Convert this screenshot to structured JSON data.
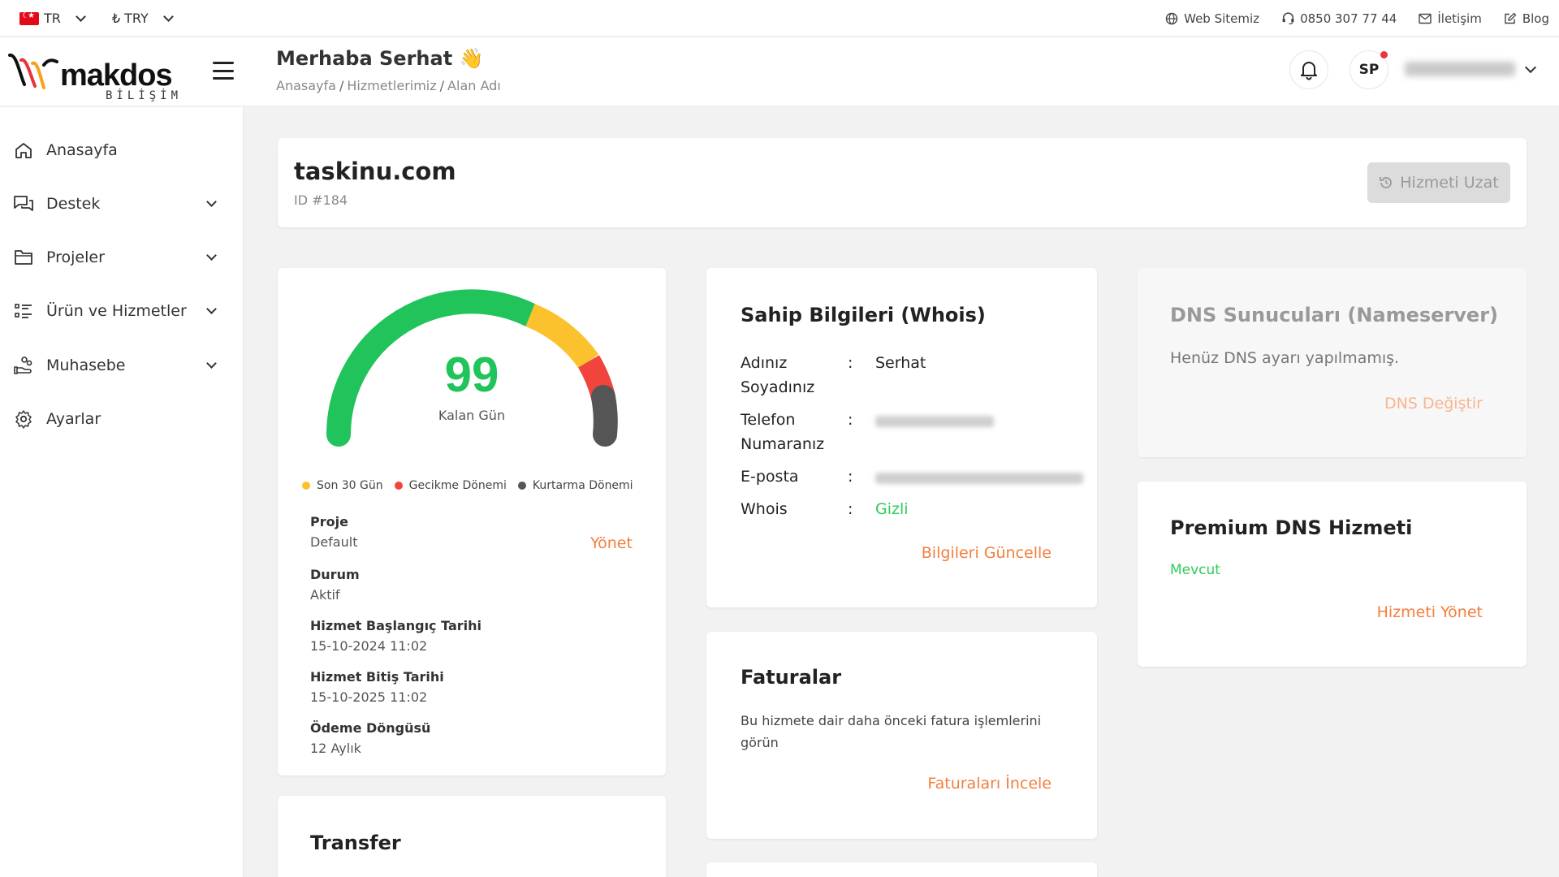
{
  "topbar": {
    "language": "TR",
    "currency": "₺ TRY",
    "links": [
      {
        "label": "Web Sitemiz",
        "icon": "globe-icon"
      },
      {
        "label": "0850 307 77 44",
        "icon": "headset-icon"
      },
      {
        "label": "İletişim",
        "icon": "mail-icon"
      },
      {
        "label": "Blog",
        "icon": "edit-icon"
      }
    ]
  },
  "header": {
    "logo": {
      "word": "makdos",
      "sub": "BİLİŞİM"
    },
    "greeting": "Merhaba Serhat 👋",
    "breadcrumb": [
      "Anasayfa",
      "Hizmetlerimiz",
      "Alan Adı"
    ],
    "avatar_initials": "SP"
  },
  "sidebar": {
    "items": [
      {
        "label": "Anasayfa",
        "icon": "home-icon"
      },
      {
        "label": "Destek",
        "icon": "chat-icon"
      },
      {
        "label": "Projeler",
        "icon": "folder-icon"
      },
      {
        "label": "Ürün ve Hizmetler",
        "icon": "list-icon"
      },
      {
        "label": "Muhasebe",
        "icon": "hand-coins-icon"
      },
      {
        "label": "Ayarlar",
        "icon": "gear-icon"
      }
    ]
  },
  "domain": {
    "name": "taskinu.com",
    "id": "ID #184",
    "renew_button": "Hizmeti Uzat"
  },
  "gauge": {
    "days_left": "99",
    "days_label": "Kalan Gün",
    "legend": [
      "Son 30 Gün",
      "Gecikme Dönemi",
      "Kurtarma Dönemi"
    ],
    "colors": {
      "active": "#20c45a",
      "last30": "#fcc22d",
      "late": "#f0443d",
      "recovery": "#555555"
    }
  },
  "details": {
    "project_label": "Proje",
    "project_value": "Default",
    "manage_link": "Yönet",
    "status_label": "Durum",
    "status_value": "Aktif",
    "start_label": "Hizmet Başlangıç Tarihi",
    "start_value": "15-10-2024 11:02",
    "end_label": "Hizmet Bitiş Tarihi",
    "end_value": "15-10-2025 11:02",
    "cycle_label": "Ödeme Döngüsü",
    "cycle_value": "12 Aylık"
  },
  "whois": {
    "title": "Sahip Bilgileri (Whois)",
    "name_label": "Adınız Soyadınız",
    "name_value": "Serhat",
    "phone_label": "Telefon Numaranız",
    "email_label": "E-posta",
    "whois_label": "Whois",
    "whois_value": "Gizli",
    "colon": ":",
    "update_link": "Bilgileri Güncelle"
  },
  "invoices": {
    "title": "Faturalar",
    "description": "Bu hizmete dair daha önceki fatura işlemlerini görün",
    "link": "Faturaları İncele"
  },
  "dns": {
    "title": "DNS Sunucuları (Nameserver)",
    "description": "Henüz DNS ayarı yapılmamış.",
    "link": "DNS Değiştir"
  },
  "premium_dns": {
    "title": "Premium DNS Hizmeti",
    "status": "Mevcut",
    "link": "Hizmeti Yönet"
  },
  "transfer": {
    "title": "Transfer"
  }
}
